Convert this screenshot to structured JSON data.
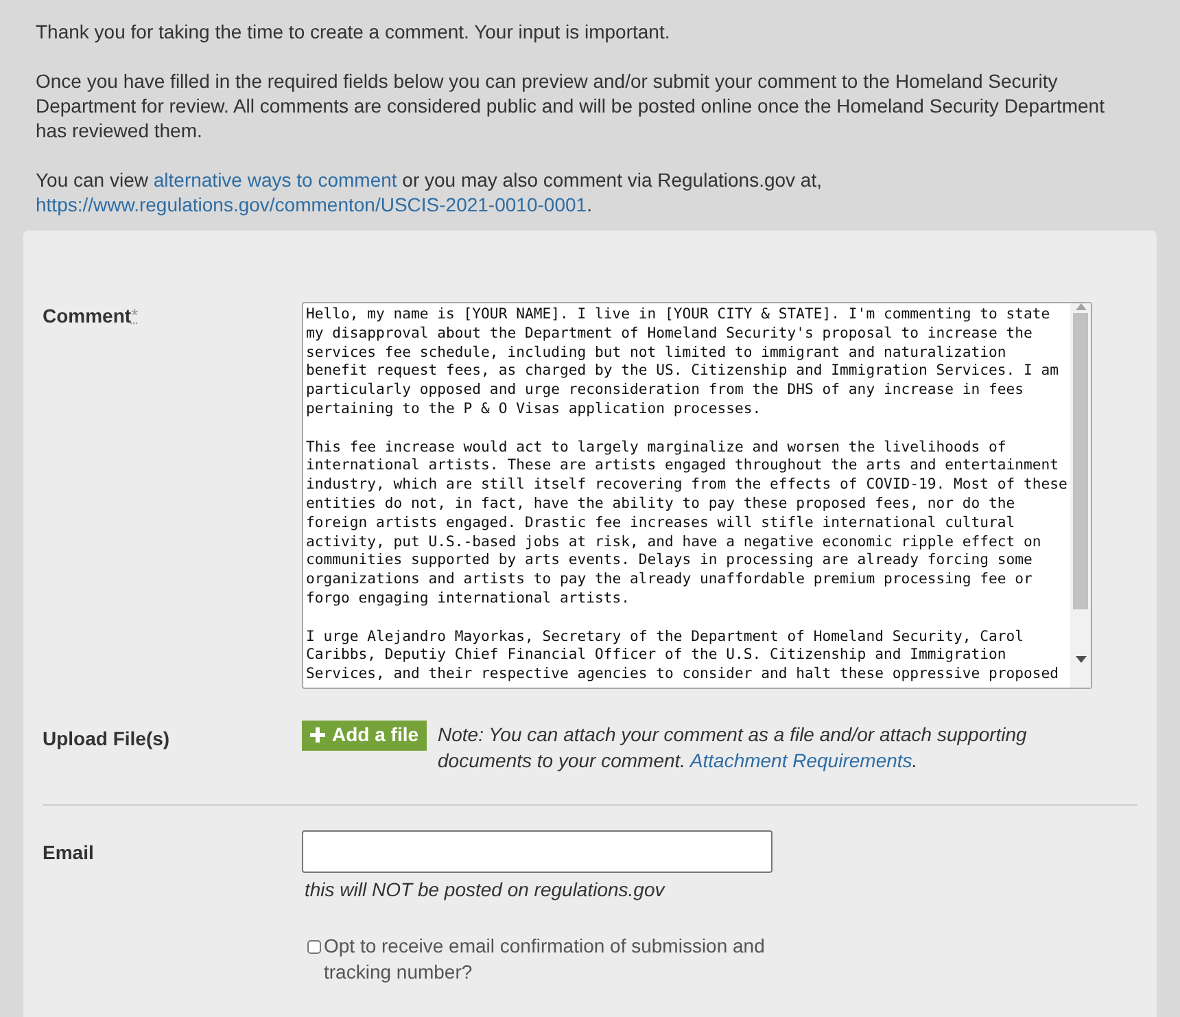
{
  "intro": {
    "thanks": "Thank you for taking the time to create a comment. Your input is important.",
    "instructions": "Once you have filled in the required fields below you can preview and/or submit your comment to the Homeland Security Department for review. All comments are considered public and will be posted online once the Homeland Security Department has reviewed them.",
    "alt_before": "You can view",
    "alt_link": "alternative ways to comment",
    "alt_after": "or you may also comment via Regulations.gov at,",
    "url_link": "https://www.regulations.gov/commenton/USCIS-2021-0010-0001",
    "url_after": "."
  },
  "comment": {
    "label": "Comment",
    "required_mark": "*",
    "paragraphs": [
      "Hello, my name is [YOUR NAME]. I live in [YOUR CITY & STATE]. I'm commenting to state my disapproval about the Department of Homeland Security's proposal to increase the services fee schedule, including but not limited to immigrant and naturalization benefit request fees, as charged by the US. Citizenship and Immigration Services. I am particularly opposed and urge reconsideration from the DHS of any increase in fees pertaining to the P & O Visas application processes.",
      "This fee increase would act to largely marginalize and worsen the livelihoods of international artists. These are artists engaged throughout the arts and entertainment industry, which are still itself recovering from the effects of COVID-19. Most of these entities do not, in fact, have the ability to pay these proposed fees, nor do the foreign artists engaged. Drastic fee increases will stifle international cultural activity, put U.S.-based jobs at risk, and have a negative economic ripple effect on communities supported by arts events. Delays in processing are already forcing some organizations and artists to pay the already unaffordable premium processing fee or forgo engaging international artists.",
      "I urge Alejandro Mayorkas, Secretary of the Department of Homeland Security, Carol Caribbs, Deputiy Chief Financial Officer of the U.S. Citizenship and Immigration Services, and their respective agencies to consider and halt these oppressive proposed"
    ]
  },
  "upload": {
    "label": "Upload File(s)",
    "button": "Add a file",
    "note": "Note: You can attach your comment as a file and/or attach supporting documents to your comment.",
    "link": "Attachment Requirements",
    "after": "."
  },
  "email": {
    "label": "Email",
    "hint": "this will NOT be posted on regulations.gov",
    "opt_in": {
      "label": "Opt to receive email confirmation of submission and tracking number?",
      "checked": false
    }
  }
}
